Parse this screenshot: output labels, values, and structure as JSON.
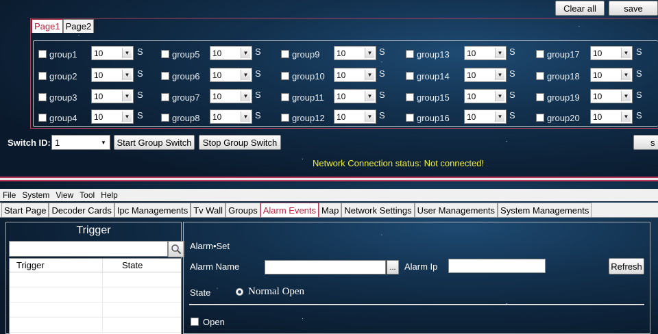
{
  "top": {
    "buttons": {
      "clear_all": "Clear all",
      "save": "save",
      "start_group_switch": "Start Group Switch",
      "stop_group_switch": "Stop Group Switch",
      "partial": "s"
    },
    "tabs": [
      "Page1",
      "Page2"
    ],
    "active_tab": "Page1",
    "groups": [
      {
        "name": "group1",
        "interval": "10"
      },
      {
        "name": "group2",
        "interval": "10"
      },
      {
        "name": "group3",
        "interval": "10"
      },
      {
        "name": "group4",
        "interval": "10"
      },
      {
        "name": "group5",
        "interval": "10"
      },
      {
        "name": "group6",
        "interval": "10"
      },
      {
        "name": "group7",
        "interval": "10"
      },
      {
        "name": "group8",
        "interval": "10"
      },
      {
        "name": "group9",
        "interval": "10"
      },
      {
        "name": "group10",
        "interval": "10"
      },
      {
        "name": "group11",
        "interval": "10"
      },
      {
        "name": "group12",
        "interval": "10"
      },
      {
        "name": "group13",
        "interval": "10"
      },
      {
        "name": "group14",
        "interval": "10"
      },
      {
        "name": "group15",
        "interval": "10"
      },
      {
        "name": "group16",
        "interval": "10"
      },
      {
        "name": "group17",
        "interval": "10"
      },
      {
        "name": "group18",
        "interval": "10"
      },
      {
        "name": "group19",
        "interval": "10"
      },
      {
        "name": "group20",
        "interval": "10"
      }
    ],
    "unit": "S",
    "switch_id_label": "Switch ID:",
    "switch_id_value": "1",
    "network_status": "Network Connection status: Not connected!"
  },
  "bottom": {
    "menu": [
      "File",
      "System",
      "View",
      "Tool",
      "Help"
    ],
    "tabs": [
      "Start Page",
      "Decoder Cards",
      "Ipc Managements",
      "Tv Wall",
      "Groups",
      "Alarm Events",
      "Map",
      "Network Settings",
      "User Managements",
      "System Managements"
    ],
    "active_tab": "Alarm Events",
    "trigger": {
      "title": "Trigger",
      "search_value": "",
      "columns": [
        "Trigger",
        "State"
      ]
    },
    "alarm": {
      "section_title": "Alarm•Set",
      "alarm_name_label": "Alarm Name",
      "alarm_name_value": "",
      "browse_label": "...",
      "alarm_ip_label": "Alarm Ip",
      "alarm_ip_value": "",
      "refresh_label": "Refresh",
      "state_label": "State",
      "state_option": "Normal Open",
      "open_label": "Open"
    }
  },
  "colors": {
    "accent_red": "#c0203a",
    "status_yellow": "#f2f238",
    "divider": "#c0365f"
  }
}
